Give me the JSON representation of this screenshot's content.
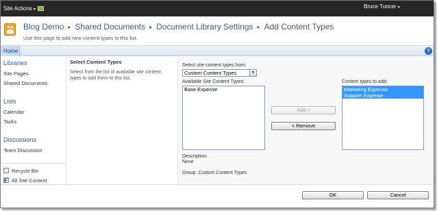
{
  "topbar": {
    "site_actions_label": "Site Actions",
    "site_actions_caret": "▾",
    "user_name": "Bruce Tuncer",
    "user_caret": "▾"
  },
  "title": {
    "breadcrumb": [
      "Blog Demo",
      "Shared Documents",
      "Document Library Settings"
    ],
    "separator": "▸",
    "current_page": "Add Content Types",
    "description": "Use this page to add new content types to this list."
  },
  "nav": {
    "home_tab": "Home",
    "help_glyph": "?"
  },
  "quicklaunch": {
    "libraries_heading": "Libraries",
    "libraries_items": [
      "Site Pages",
      "Shared Documents"
    ],
    "lists_heading": "Lists",
    "lists_items": [
      "Calendar",
      "Tasks"
    ],
    "discussions_heading": "Discussions",
    "discussions_items": [
      "Team Discussion"
    ],
    "recycle_bin": "Recycle Bin",
    "all_site_content": "All Site Content"
  },
  "form": {
    "section_title": "Select Content Types",
    "section_description": "Select from the list of available site content types to add them to this list.",
    "select_from_label": "Select site content types from:",
    "select_from_value": "Custom Content Types",
    "available_label": "Available Site Content Types:",
    "available_items": [
      "Base Expense"
    ],
    "add_button": "Add >",
    "remove_button": "< Remove",
    "to_add_label": "Content types to add:",
    "to_add_items": [
      "Marketing Expense",
      "Support Expense"
    ],
    "description_label": "Description:",
    "description_value": "None",
    "group_label": "Group: Custom Content Types"
  },
  "footer": {
    "ok_button": "OK",
    "cancel_button": "Cancel"
  },
  "colors": {
    "topbar": "#262626",
    "link_blue": "#2e5da3",
    "selection": "#3399ff"
  }
}
